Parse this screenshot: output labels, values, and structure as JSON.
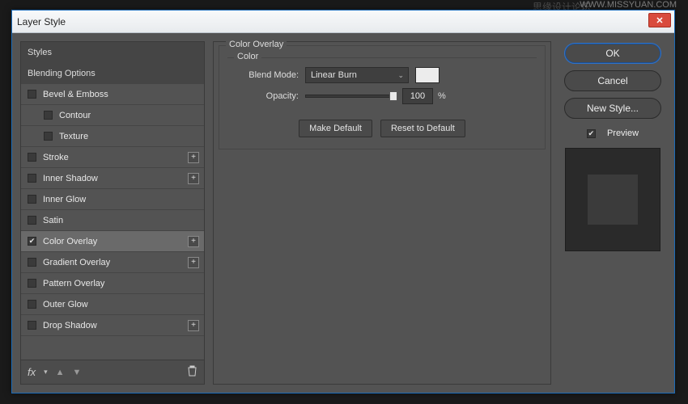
{
  "watermark": {
    "url": "WWW.MISSYUAN.COM",
    "forum": "思缘设计论坛"
  },
  "dialog": {
    "title": "Layer Style"
  },
  "sidebar": {
    "styles_header": "Styles",
    "blending_header": "Blending Options",
    "items": [
      {
        "label": "Bevel & Emboss",
        "checked": false,
        "plus": false
      },
      {
        "label": "Contour",
        "checked": false,
        "plus": false,
        "sub": true
      },
      {
        "label": "Texture",
        "checked": false,
        "plus": false,
        "sub": true
      },
      {
        "label": "Stroke",
        "checked": false,
        "plus": true
      },
      {
        "label": "Inner Shadow",
        "checked": false,
        "plus": true
      },
      {
        "label": "Inner Glow",
        "checked": false,
        "plus": false
      },
      {
        "label": "Satin",
        "checked": false,
        "plus": false
      },
      {
        "label": "Color Overlay",
        "checked": true,
        "plus": true,
        "selected": true
      },
      {
        "label": "Gradient Overlay",
        "checked": false,
        "plus": true
      },
      {
        "label": "Pattern Overlay",
        "checked": false,
        "plus": false
      },
      {
        "label": "Outer Glow",
        "checked": false,
        "plus": false
      },
      {
        "label": "Drop Shadow",
        "checked": false,
        "plus": true
      }
    ],
    "footer_fx": "fx"
  },
  "panel": {
    "group_title": "Color Overlay",
    "color_group": "Color",
    "blend_label": "Blend Mode:",
    "blend_value": "Linear Burn",
    "opacity_label": "Opacity:",
    "opacity_value": "100",
    "opacity_unit": "%",
    "make_default": "Make Default",
    "reset_default": "Reset to Default",
    "swatch_color": "#ececec"
  },
  "actions": {
    "ok": "OK",
    "cancel": "Cancel",
    "new_style": "New Style...",
    "preview": "Preview",
    "preview_checked": true
  }
}
